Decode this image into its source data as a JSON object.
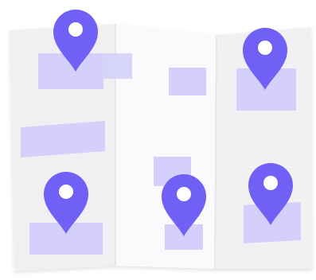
{
  "illustration": {
    "subject": "folded-map-with-location-pins",
    "pin_count": 5,
    "colors": {
      "pin": "#7060F5",
      "pin_hole": "#FFFFFF",
      "block": "#D4D0FB",
      "panel_left": "#F0F0F3",
      "panel_mid": "#FAFAFC",
      "panel_right": "#F1F1F4"
    },
    "icons": [
      "map-icon",
      "location-pin-icon"
    ]
  }
}
